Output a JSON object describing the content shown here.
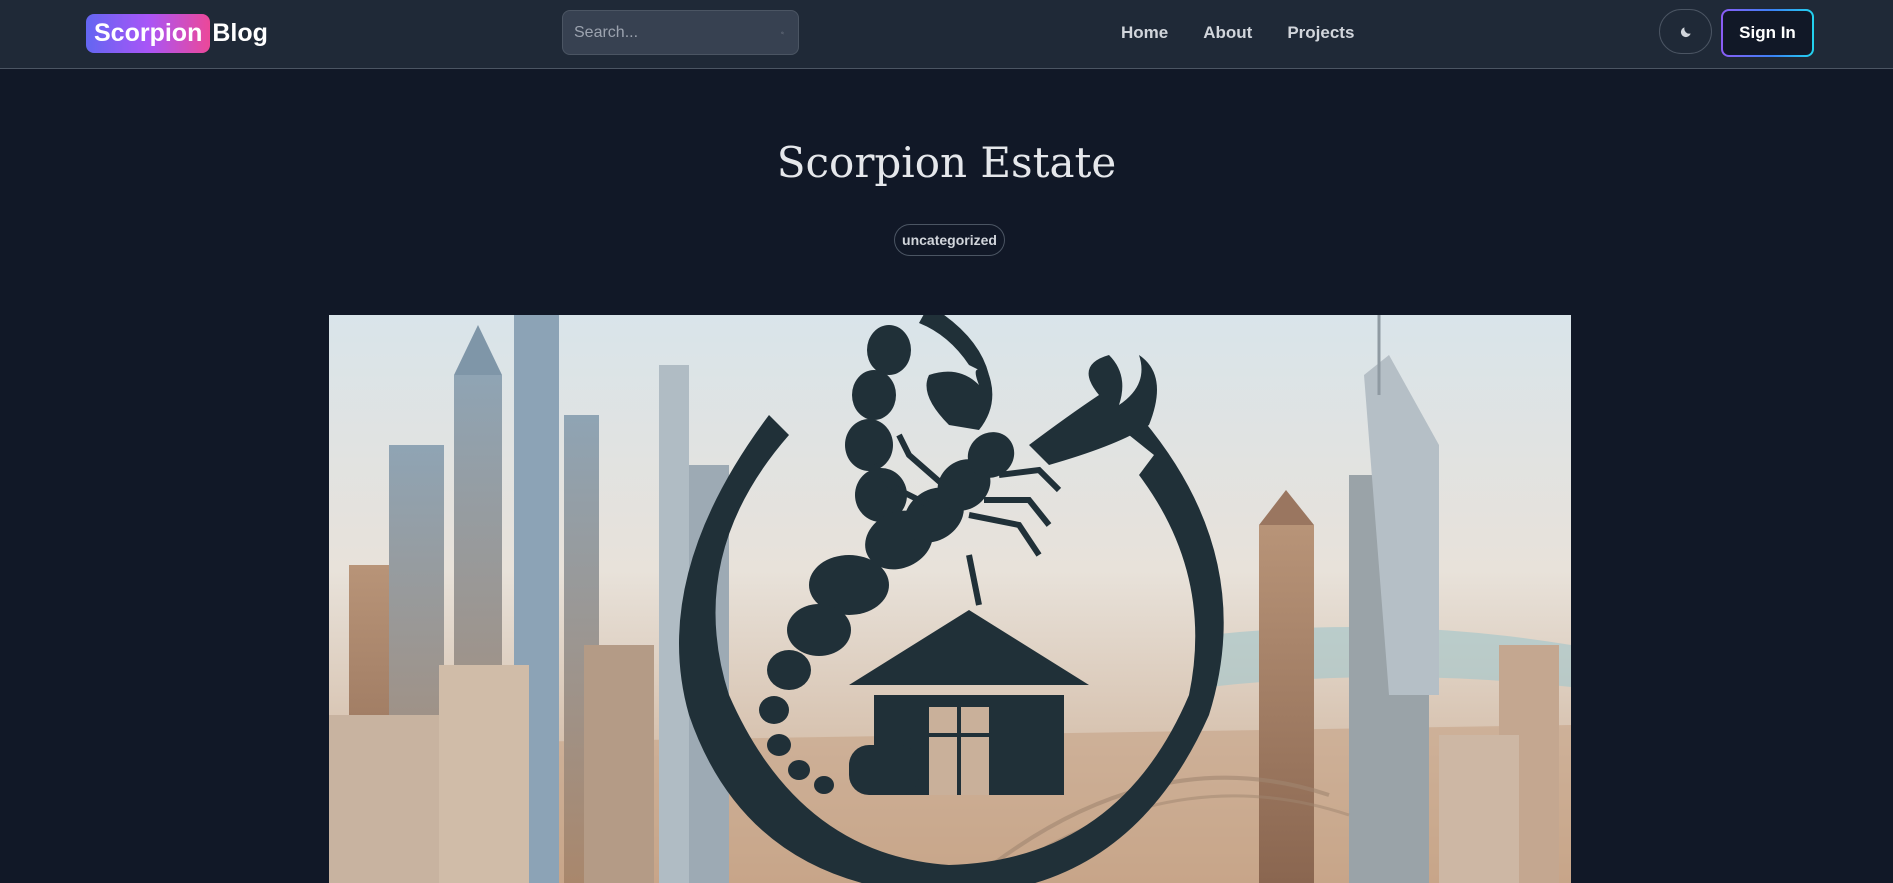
{
  "navbar": {
    "brand_highlight": "Scorpion",
    "brand_rest": "Blog",
    "search_placeholder": "Search...",
    "links": [
      "Home",
      "About",
      "Projects"
    ],
    "sign_in_label": "Sign In"
  },
  "post": {
    "title": "Scorpion Estate",
    "category": "uncategorized",
    "hero_image": "scorpion-house-logo-over-city-skyline"
  },
  "icons": {
    "search": "search-icon",
    "theme": "moon-icon"
  },
  "colors": {
    "background": "#111827",
    "navbar": "#1f2937",
    "logo_fill": "#203038"
  }
}
